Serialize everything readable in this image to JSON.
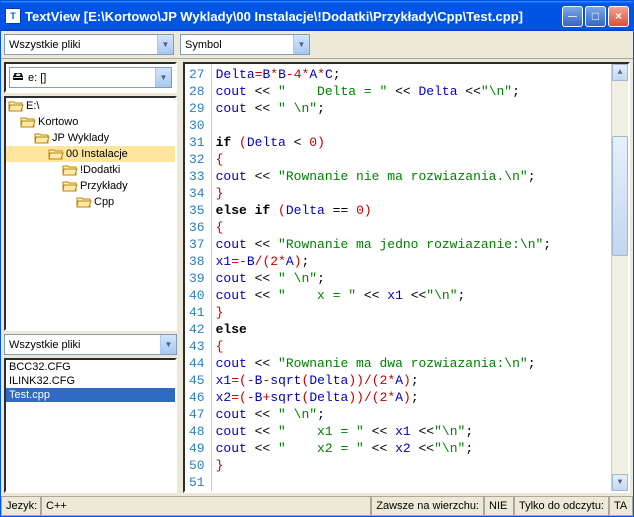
{
  "title": "TextView [E:\\Kortowo\\JP Wyklady\\00 Instalacje\\!Dodatki\\Przykłady\\Cpp\\Test.cpp]",
  "toolbar": {
    "filter": "Wszystkie pliki",
    "symbol": "Symbol"
  },
  "drive": {
    "label": "e: []"
  },
  "tree": [
    {
      "label": "E:\\",
      "indent": 0,
      "open": true
    },
    {
      "label": "Kortowo",
      "indent": 1,
      "open": true
    },
    {
      "label": "JP Wyklady",
      "indent": 2,
      "open": true
    },
    {
      "label": "00 Instalacje",
      "indent": 3,
      "open": true,
      "selected": true
    },
    {
      "label": "!Dodatki",
      "indent": 4,
      "open": true
    },
    {
      "label": "Przykłady",
      "indent": 4,
      "open": true
    },
    {
      "label": "Cpp",
      "indent": 5,
      "open": true
    }
  ],
  "filter2": "Wszystkie pliki",
  "files": [
    {
      "name": "BCC32.CFG"
    },
    {
      "name": "ILINK32.CFG"
    },
    {
      "name": "Test.cpp",
      "selected": true
    }
  ],
  "code": {
    "start": 27,
    "lines": [
      [
        {
          "t": "Delta",
          "c": "id"
        },
        {
          "t": "=",
          "c": "eop"
        },
        {
          "t": "B",
          "c": "id"
        },
        {
          "t": "*",
          "c": "eop"
        },
        {
          "t": "B",
          "c": "id"
        },
        {
          "t": "-",
          "c": "eop"
        },
        {
          "t": "4",
          "c": "num"
        },
        {
          "t": "*",
          "c": "eop"
        },
        {
          "t": "A",
          "c": "id"
        },
        {
          "t": "*",
          "c": "eop"
        },
        {
          "t": "C",
          "c": "id"
        },
        {
          "t": ";",
          "c": "op"
        }
      ],
      [
        {
          "t": "cout",
          "c": "id"
        },
        {
          "t": " << ",
          "c": "op"
        },
        {
          "t": "\"    Delta = \"",
          "c": "str"
        },
        {
          "t": " << ",
          "c": "op"
        },
        {
          "t": "Delta",
          "c": "id"
        },
        {
          "t": " <<",
          "c": "op"
        },
        {
          "t": "\"\\n\"",
          "c": "str"
        },
        {
          "t": ";",
          "c": "op"
        }
      ],
      [
        {
          "t": "cout",
          "c": "id"
        },
        {
          "t": " << ",
          "c": "op"
        },
        {
          "t": "\" \\n\"",
          "c": "str"
        },
        {
          "t": ";",
          "c": "op"
        }
      ],
      [],
      [
        {
          "t": "if",
          "c": "kw"
        },
        {
          "t": " ",
          "c": "op"
        },
        {
          "t": "(",
          "c": "par"
        },
        {
          "t": "Delta",
          "c": "id"
        },
        {
          "t": " < ",
          "c": "op"
        },
        {
          "t": "0",
          "c": "num"
        },
        {
          "t": ")",
          "c": "par"
        }
      ],
      [
        {
          "t": "{",
          "c": "par"
        }
      ],
      [
        {
          "t": "cout",
          "c": "id"
        },
        {
          "t": " << ",
          "c": "op"
        },
        {
          "t": "\"Rownanie nie ma rozwiazania.\\n\"",
          "c": "str"
        },
        {
          "t": ";",
          "c": "op"
        }
      ],
      [
        {
          "t": "}",
          "c": "par"
        }
      ],
      [
        {
          "t": "else if",
          "c": "kw"
        },
        {
          "t": " ",
          "c": "op"
        },
        {
          "t": "(",
          "c": "par"
        },
        {
          "t": "Delta",
          "c": "id"
        },
        {
          "t": " == ",
          "c": "op"
        },
        {
          "t": "0",
          "c": "num"
        },
        {
          "t": ")",
          "c": "par"
        }
      ],
      [
        {
          "t": "{",
          "c": "par"
        }
      ],
      [
        {
          "t": "cout",
          "c": "id"
        },
        {
          "t": " << ",
          "c": "op"
        },
        {
          "t": "\"Rownanie ma jedno rozwiazanie:\\n\"",
          "c": "str"
        },
        {
          "t": ";",
          "c": "op"
        }
      ],
      [
        {
          "t": "x1",
          "c": "id"
        },
        {
          "t": "=-",
          "c": "eop"
        },
        {
          "t": "B",
          "c": "id"
        },
        {
          "t": "/",
          "c": "eop"
        },
        {
          "t": "(",
          "c": "par"
        },
        {
          "t": "2",
          "c": "num"
        },
        {
          "t": "*",
          "c": "eop"
        },
        {
          "t": "A",
          "c": "id"
        },
        {
          "t": ")",
          "c": "par"
        },
        {
          "t": ";",
          "c": "op"
        }
      ],
      [
        {
          "t": "cout",
          "c": "id"
        },
        {
          "t": " << ",
          "c": "op"
        },
        {
          "t": "\" \\n\"",
          "c": "str"
        },
        {
          "t": ";",
          "c": "op"
        }
      ],
      [
        {
          "t": "cout",
          "c": "id"
        },
        {
          "t": " << ",
          "c": "op"
        },
        {
          "t": "\"    x = \"",
          "c": "str"
        },
        {
          "t": " << ",
          "c": "op"
        },
        {
          "t": "x1",
          "c": "id"
        },
        {
          "t": " <<",
          "c": "op"
        },
        {
          "t": "\"\\n\"",
          "c": "str"
        },
        {
          "t": ";",
          "c": "op"
        }
      ],
      [
        {
          "t": "}",
          "c": "par"
        }
      ],
      [
        {
          "t": "else",
          "c": "kw"
        }
      ],
      [
        {
          "t": "{",
          "c": "par"
        }
      ],
      [
        {
          "t": "cout",
          "c": "id"
        },
        {
          "t": " << ",
          "c": "op"
        },
        {
          "t": "\"Rownanie ma dwa rozwiazania:\\n\"",
          "c": "str"
        },
        {
          "t": ";",
          "c": "op"
        }
      ],
      [
        {
          "t": "x1",
          "c": "id"
        },
        {
          "t": "=",
          "c": "eop"
        },
        {
          "t": "(",
          "c": "par"
        },
        {
          "t": "-",
          "c": "eop"
        },
        {
          "t": "B",
          "c": "id"
        },
        {
          "t": "-",
          "c": "eop"
        },
        {
          "t": "sqrt",
          "c": "id"
        },
        {
          "t": "(",
          "c": "par"
        },
        {
          "t": "Delta",
          "c": "id"
        },
        {
          "t": ")",
          "c": "par"
        },
        {
          "t": ")",
          "c": "par"
        },
        {
          "t": "/",
          "c": "eop"
        },
        {
          "t": "(",
          "c": "par"
        },
        {
          "t": "2",
          "c": "num"
        },
        {
          "t": "*",
          "c": "eop"
        },
        {
          "t": "A",
          "c": "id"
        },
        {
          "t": ")",
          "c": "par"
        },
        {
          "t": ";",
          "c": "op"
        }
      ],
      [
        {
          "t": "x2",
          "c": "id"
        },
        {
          "t": "=",
          "c": "eop"
        },
        {
          "t": "(",
          "c": "par"
        },
        {
          "t": "-",
          "c": "eop"
        },
        {
          "t": "B",
          "c": "id"
        },
        {
          "t": "+",
          "c": "eop"
        },
        {
          "t": "sqrt",
          "c": "id"
        },
        {
          "t": "(",
          "c": "par"
        },
        {
          "t": "Delta",
          "c": "id"
        },
        {
          "t": ")",
          "c": "par"
        },
        {
          "t": ")",
          "c": "par"
        },
        {
          "t": "/",
          "c": "eop"
        },
        {
          "t": "(",
          "c": "par"
        },
        {
          "t": "2",
          "c": "num"
        },
        {
          "t": "*",
          "c": "eop"
        },
        {
          "t": "A",
          "c": "id"
        },
        {
          "t": ")",
          "c": "par"
        },
        {
          "t": ";",
          "c": "op"
        }
      ],
      [
        {
          "t": "cout",
          "c": "id"
        },
        {
          "t": " << ",
          "c": "op"
        },
        {
          "t": "\" \\n\"",
          "c": "str"
        },
        {
          "t": ";",
          "c": "op"
        }
      ],
      [
        {
          "t": "cout",
          "c": "id"
        },
        {
          "t": " << ",
          "c": "op"
        },
        {
          "t": "\"    x1 = \"",
          "c": "str"
        },
        {
          "t": " << ",
          "c": "op"
        },
        {
          "t": "x1",
          "c": "id"
        },
        {
          "t": " <<",
          "c": "op"
        },
        {
          "t": "\"\\n\"",
          "c": "str"
        },
        {
          "t": ";",
          "c": "op"
        }
      ],
      [
        {
          "t": "cout",
          "c": "id"
        },
        {
          "t": " << ",
          "c": "op"
        },
        {
          "t": "\"    x2 = \"",
          "c": "str"
        },
        {
          "t": " << ",
          "c": "op"
        },
        {
          "t": "x2",
          "c": "id"
        },
        {
          "t": " <<",
          "c": "op"
        },
        {
          "t": "\"\\n\"",
          "c": "str"
        },
        {
          "t": ";",
          "c": "op"
        }
      ],
      [
        {
          "t": "}",
          "c": "par"
        }
      ],
      []
    ]
  },
  "status": {
    "lang_label": "Jezyk:",
    "lang_value": "C++",
    "top_label": "Zawsze na wierzchu:",
    "top_value": "NIE",
    "ro_label": "Tylko do odczytu:",
    "ro_value": "TA"
  }
}
